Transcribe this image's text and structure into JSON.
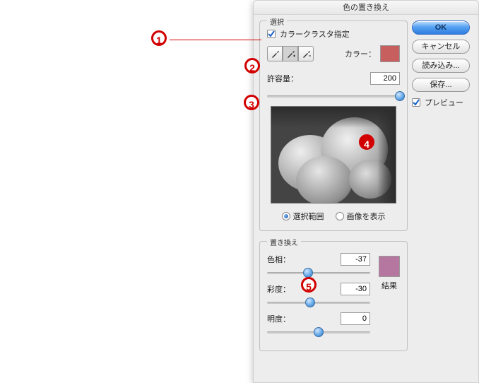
{
  "dialog": {
    "title": "色の置き換え",
    "selection": {
      "legend": "選択",
      "cluster_label": "カラークラスタ指定",
      "cluster_checked": true,
      "color_label": "カラー：",
      "color_swatch": "#c85f5f",
      "tolerance_label": "許容量：",
      "tolerance_value": "200",
      "tolerance_pct": 100,
      "radio_selection": "選択範囲",
      "radio_image": "画像を表示",
      "radio_checked": "selection"
    },
    "replace": {
      "legend": "置き換え",
      "hue_label": "色相：",
      "hue_value": "-37",
      "hue_pct": 40,
      "sat_label": "彩度：",
      "sat_value": "-30",
      "sat_pct": 42,
      "light_label": "明度：",
      "light_value": "0",
      "light_pct": 50,
      "result_label": "結果",
      "result_swatch": "#b577a0"
    }
  },
  "buttons": {
    "ok": "OK",
    "cancel": "キャンセル",
    "load": "読み込み...",
    "save": "保存...",
    "preview": "プレビュー",
    "preview_checked": true
  },
  "markers": {
    "m1": "1",
    "m2": "2",
    "m3": "3",
    "m4": "4",
    "m5": "5"
  }
}
